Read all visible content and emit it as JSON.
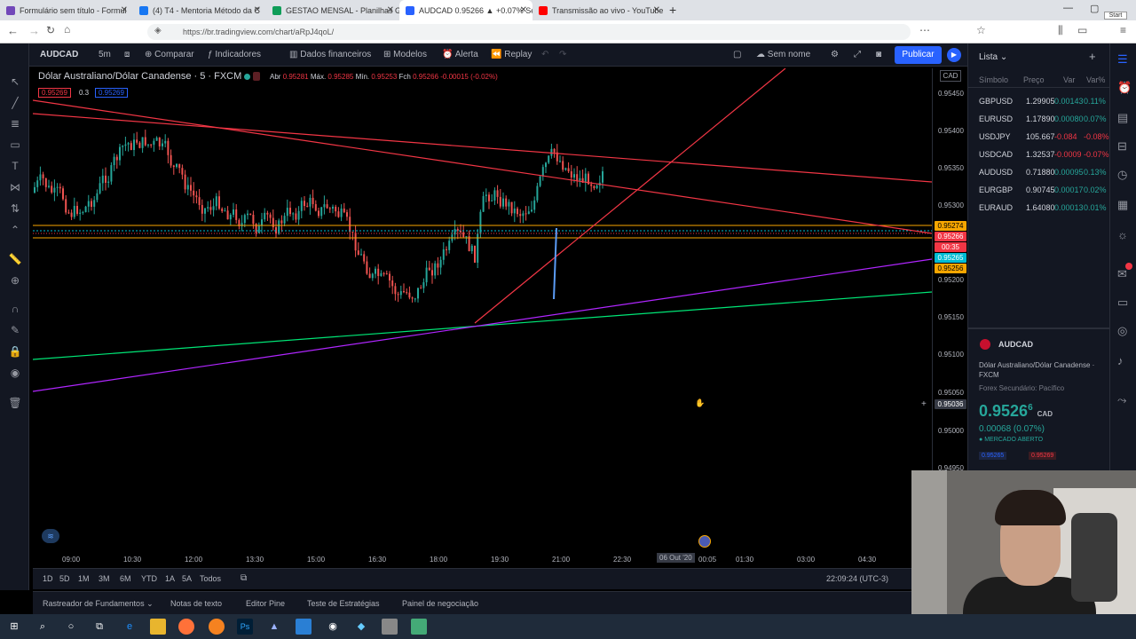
{
  "browser": {
    "tabs": [
      {
        "label": "Formulário sem título - Formul",
        "color": "#7248b9"
      },
      {
        "label": "(4) T4 - Mentoria Método da C",
        "color": "#1877f2"
      },
      {
        "label": "GESTAO MENSAL - Planilhas G",
        "color": "#0f9d58"
      },
      {
        "label": "AUDCAD 0.95266 ▲ +0.07% Se",
        "color": "#2962ff"
      },
      {
        "label": "Transmissão ao vivo - YouTube",
        "color": "#ff0000"
      }
    ],
    "url": "https://br.tradingview.com/chart/aRpJ4qoL/",
    "start_label": "Start"
  },
  "toolbar": {
    "symbol": "AUDCAD",
    "interval": "5m",
    "compare": "Comparar",
    "indicators": "Indicadores",
    "financials": "Dados financeiros",
    "templates": "Modelos",
    "alert": "Alerta",
    "replay": "Replay",
    "layout_name": "Sem nome",
    "publish": "Publicar"
  },
  "chart": {
    "title": "Dólar Australiano/Dólar Canadense · 5 · FXCM",
    "ohlc": {
      "o_label": "Abr",
      "o": "0.95281",
      "h_label": "Máx.",
      "h": "0.95285",
      "l_label": "Mín.",
      "l": "0.95253",
      "c_label": "Fch",
      "c": "0.95266",
      "chg": "-0.00015 (-0.02%)"
    },
    "bid": "0.95269",
    "spread": "0.3",
    "ask": "0.95269",
    "currency": "CAD",
    "price_labels": [
      "0.95450",
      "0.95400",
      "0.95350",
      "0.95300",
      "0.95200",
      "0.95150",
      "0.95100",
      "0.95050",
      "0.95000",
      "0.94950"
    ],
    "price_tags": [
      {
        "value": "0.95274",
        "color": "#f7a600"
      },
      {
        "value": "0.95266",
        "color": "#f23645"
      },
      {
        "value": "00:35",
        "color": "#f23645"
      },
      {
        "value": "0.95265",
        "color": "#00bcd4"
      },
      {
        "value": "0.95256",
        "color": "#f7a600"
      }
    ],
    "crosshair_price": "0.95036",
    "time_labels": [
      "09:00",
      "10:30",
      "12:00",
      "13:30",
      "15:00",
      "16:30",
      "18:00",
      "19:30",
      "21:00",
      "22:30",
      "06 Out '20",
      "00:05",
      "01:30",
      "03:00",
      "04:30"
    ]
  },
  "range_bar": {
    "ranges": [
      "1D",
      "5D",
      "1M",
      "3M",
      "6M",
      "YTD",
      "1A",
      "5A",
      "Todos"
    ],
    "clock": "22:09:24 (UTC-3)"
  },
  "bottom_tabs": [
    "Rastreador de Fundamentos",
    "Notas de texto",
    "Editor Pine",
    "Teste de Estratégias",
    "Painel de negociação"
  ],
  "watchlist": {
    "title": "Lista",
    "headers": [
      "Símbolo",
      "Preço",
      "Var",
      "Var%"
    ],
    "rows": [
      {
        "symbol": "GBPUSD",
        "price": "1.29905",
        "chg": "0.00143",
        "pct": "0.11%",
        "up": true
      },
      {
        "symbol": "EURUSD",
        "price": "1.17890",
        "chg": "0.00080",
        "pct": "0.07%",
        "up": true
      },
      {
        "symbol": "USDJPY",
        "price": "105.667",
        "chg": "-0.084",
        "pct": "-0.08%",
        "up": false
      },
      {
        "symbol": "USDCAD",
        "price": "1.32537",
        "chg": "-0.0009",
        "pct": "-0.07%",
        "up": false
      },
      {
        "symbol": "AUDUSD",
        "price": "0.71880",
        "chg": "0.00095",
        "pct": "0.13%",
        "up": true
      },
      {
        "symbol": "EURGBP",
        "price": "0.90745",
        "chg": "0.00017",
        "pct": "0.02%",
        "up": true
      },
      {
        "symbol": "EURAUD",
        "price": "1.64080",
        "chg": "0.00013",
        "pct": "0.01%",
        "up": true
      }
    ]
  },
  "details": {
    "symbol": "AUDCAD",
    "name": "Dólar Australiano/Dólar Canadense · FXCM",
    "type": "Forex Secundário: Pacífico",
    "price": "0.9526",
    "price_sup": "6",
    "currency": "CAD",
    "change": "0.00068 (0.07%)",
    "market": "MERCADO ABERTO",
    "bid": "0.95265",
    "ask": "0.95269"
  }
}
